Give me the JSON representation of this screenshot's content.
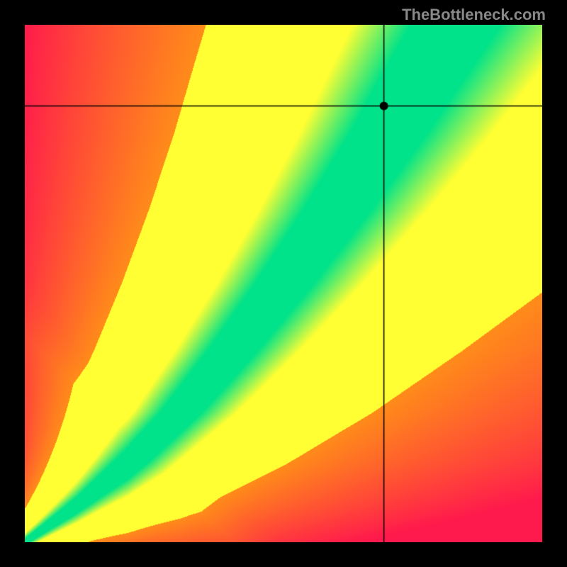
{
  "attribution": "TheBottleneck.com",
  "chart_data": {
    "type": "heatmap",
    "title": "",
    "xlabel": "",
    "ylabel": "",
    "xlim": [
      0,
      1
    ],
    "ylim": [
      0,
      1
    ],
    "colorscale": {
      "optimal": "#00e38a",
      "near": "#ffff33",
      "moderate": "#ff8c1a",
      "worst": "#ff1a4d"
    },
    "ridge": {
      "description": "green optimal band along a superlinear curve from bottom-left to top-right",
      "points_xy": [
        [
          0.0,
          0.0
        ],
        [
          0.1,
          0.07
        ],
        [
          0.2,
          0.15
        ],
        [
          0.3,
          0.25
        ],
        [
          0.4,
          0.37
        ],
        [
          0.5,
          0.5
        ],
        [
          0.6,
          0.64
        ],
        [
          0.7,
          0.79
        ],
        [
          0.78,
          0.92
        ],
        [
          0.83,
          1.0
        ]
      ],
      "band_halfwidth_frac": 0.045
    },
    "crosshair": {
      "x": 0.695,
      "y": 0.843
    },
    "marker": {
      "x": 0.695,
      "y": 0.843,
      "shape": "circle",
      "color": "#000000",
      "radius_px": 6
    }
  }
}
